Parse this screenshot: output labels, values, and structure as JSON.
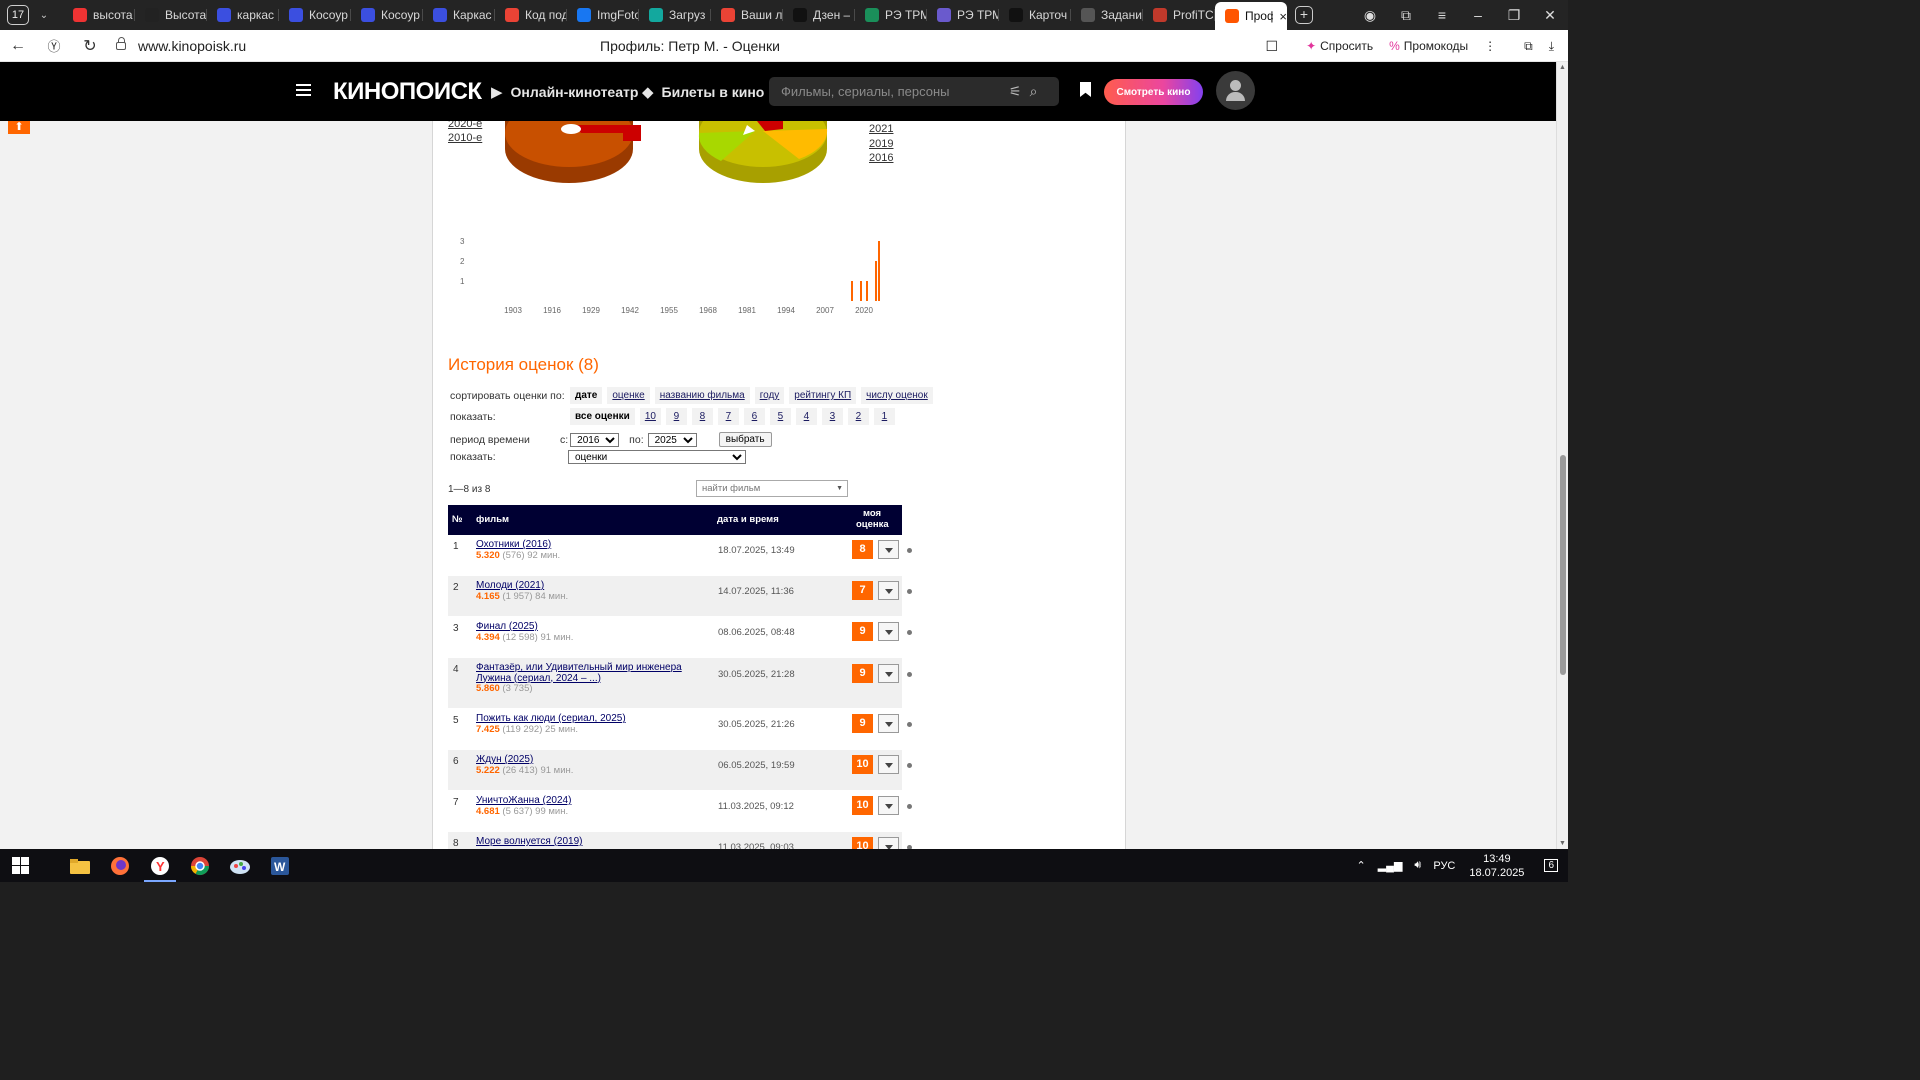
{
  "browser": {
    "tab_counter": "17",
    "tabs": [
      {
        "title": "высота",
        "icon": "yandex-icon",
        "color": "#e33"
      },
      {
        "title": "Высота",
        "icon": "sparkle-icon",
        "color": "#222"
      },
      {
        "title": "каркас",
        "icon": "ring-icon",
        "color": "#3b4fe0"
      },
      {
        "title": "Косоур",
        "icon": "ring-icon",
        "color": "#3b4fe0"
      },
      {
        "title": "Косоур",
        "icon": "ring-icon",
        "color": "#3b4fe0"
      },
      {
        "title": "Каркас",
        "icon": "ring-icon",
        "color": "#3b4fe0"
      },
      {
        "title": "Код под",
        "icon": "gmail-icon",
        "color": "#ea4335"
      },
      {
        "title": "ImgFoto",
        "icon": "f-icon",
        "color": "#1877f2"
      },
      {
        "title": "Загруз",
        "icon": "ch-icon",
        "color": "#13a89e"
      },
      {
        "title": "Ваши л",
        "icon": "gmail-icon",
        "color": "#ea4335"
      },
      {
        "title": "Дзен –",
        "icon": "zen-icon",
        "color": "#111"
      },
      {
        "title": "РЭ ТРМ",
        "icon": "wave-icon",
        "color": "#1a8f5a"
      },
      {
        "title": "РЭ ТРМ",
        "icon": "doc-icon",
        "color": "#6a5acd"
      },
      {
        "title": "Карточ",
        "icon": "a-icon",
        "color": "#111"
      },
      {
        "title": "Задани",
        "icon": "sp-icon",
        "color": "#555"
      },
      {
        "title": "ProfiTC",
        "icon": "chart-icon",
        "color": "#c0392b"
      },
      {
        "title": "Проф",
        "icon": "kinopoisk-icon",
        "color": "#ff5500",
        "active": true
      }
    ],
    "url": "www.kinopoisk.ru",
    "page_title": "Профиль: Петр М. - Оценки",
    "ask_label": "Спросить",
    "promo_label": "Промокоды"
  },
  "header": {
    "logo": "КИНОПОИСК",
    "nav_online": "Онлайн-кинотеатр",
    "nav_tickets": "Билеты в кино",
    "search_placeholder": "Фильмы, сериалы, персоны",
    "watch_button": "Смотреть кино",
    "accent_color": "#ff6600"
  },
  "decades": [
    "2020-е",
    "2010-е"
  ],
  "years": [
    "2021",
    "2019",
    "2016"
  ],
  "histogram": {
    "type": "bar",
    "y_ticks": [
      "3",
      "2",
      "1"
    ],
    "x_ticks": [
      "1903",
      "1916",
      "1929",
      "1942",
      "1955",
      "1968",
      "1981",
      "1994",
      "2007",
      "2020"
    ],
    "ylim": [
      0,
      3
    ],
    "bars": [
      {
        "year": 2016,
        "value": 1
      },
      {
        "year": 2019,
        "value": 1
      },
      {
        "year": 2021,
        "value": 1
      },
      {
        "year": 2024,
        "value": 2
      },
      {
        "year": 2025,
        "value": 3
      }
    ]
  },
  "history": {
    "title": "История оценок (8)",
    "sort_label": "сортировать оценки по:",
    "sort_options": [
      "дате",
      "оценке",
      "названию фильма",
      "году",
      "рейтингу КП",
      "числу оценок"
    ],
    "show_label": "показать:",
    "show_options": [
      "все оценки",
      "10",
      "9",
      "8",
      "7",
      "6",
      "5",
      "4",
      "3",
      "2",
      "1"
    ],
    "period_label": "период времени",
    "from_label": "с:",
    "from_value": "2016",
    "to_label": "по:",
    "to_value": "2025",
    "choose_button": "выбрать",
    "show2_label": "показать:",
    "show2_value": "оценки",
    "count_text": "1—8 из 8",
    "find_placeholder": "найти фильм"
  },
  "table": {
    "col_num": "№",
    "col_film": "фильм",
    "col_date": "дата и время",
    "col_vote_1": "моя",
    "col_vote_2": "оценка",
    "rows": [
      {
        "n": "1",
        "title": "Охотники (2016)",
        "rating": "5.320",
        "votes": "(576)",
        "len": "92 мин.",
        "date": "18.07.2025, 13:49",
        "vote": "8"
      },
      {
        "n": "2",
        "title": "Молоди (2021)",
        "rating": "4.165",
        "votes": "(1 957)",
        "len": "84 мин.",
        "date": "14.07.2025, 11:36",
        "vote": "7"
      },
      {
        "n": "3",
        "title": "Финал (2025)",
        "rating": "4.394",
        "votes": "(12 598)",
        "len": "91 мин.",
        "date": "08.06.2025, 08:48",
        "vote": "9"
      },
      {
        "n": "4",
        "title": "Фантазёр, или Удивительный мир инженера Лужина (сериал, 2024 – ...)",
        "rating": "5.860",
        "votes": "(3 735)",
        "len": "",
        "date": "30.05.2025, 21:28",
        "vote": "9"
      },
      {
        "n": "5",
        "title": "Пожить как люди (сериал, 2025)",
        "rating": "7.425",
        "votes": "(119 292)",
        "len": "25 мин.",
        "date": "30.05.2025, 21:26",
        "vote": "9"
      },
      {
        "n": "6",
        "title": "Ждун (2025)",
        "rating": "5.222",
        "votes": "(26 413)",
        "len": "91 мин.",
        "date": "06.05.2025, 19:59",
        "vote": "10"
      },
      {
        "n": "7",
        "title": "УничтоЖанна (2024)",
        "rating": "4.681",
        "votes": "(5 637)",
        "len": "99 мин.",
        "date": "11.03.2025, 09:12",
        "vote": "10"
      },
      {
        "n": "8",
        "title": "Море волнуется (2019)",
        "rating": "",
        "votes": "",
        "len": "",
        "date": "11.03.2025, 09:03",
        "vote": "10"
      }
    ]
  },
  "taskbar": {
    "lang": "РУС",
    "time": "13:49",
    "date": "18.07.2025",
    "notifications": "6"
  }
}
